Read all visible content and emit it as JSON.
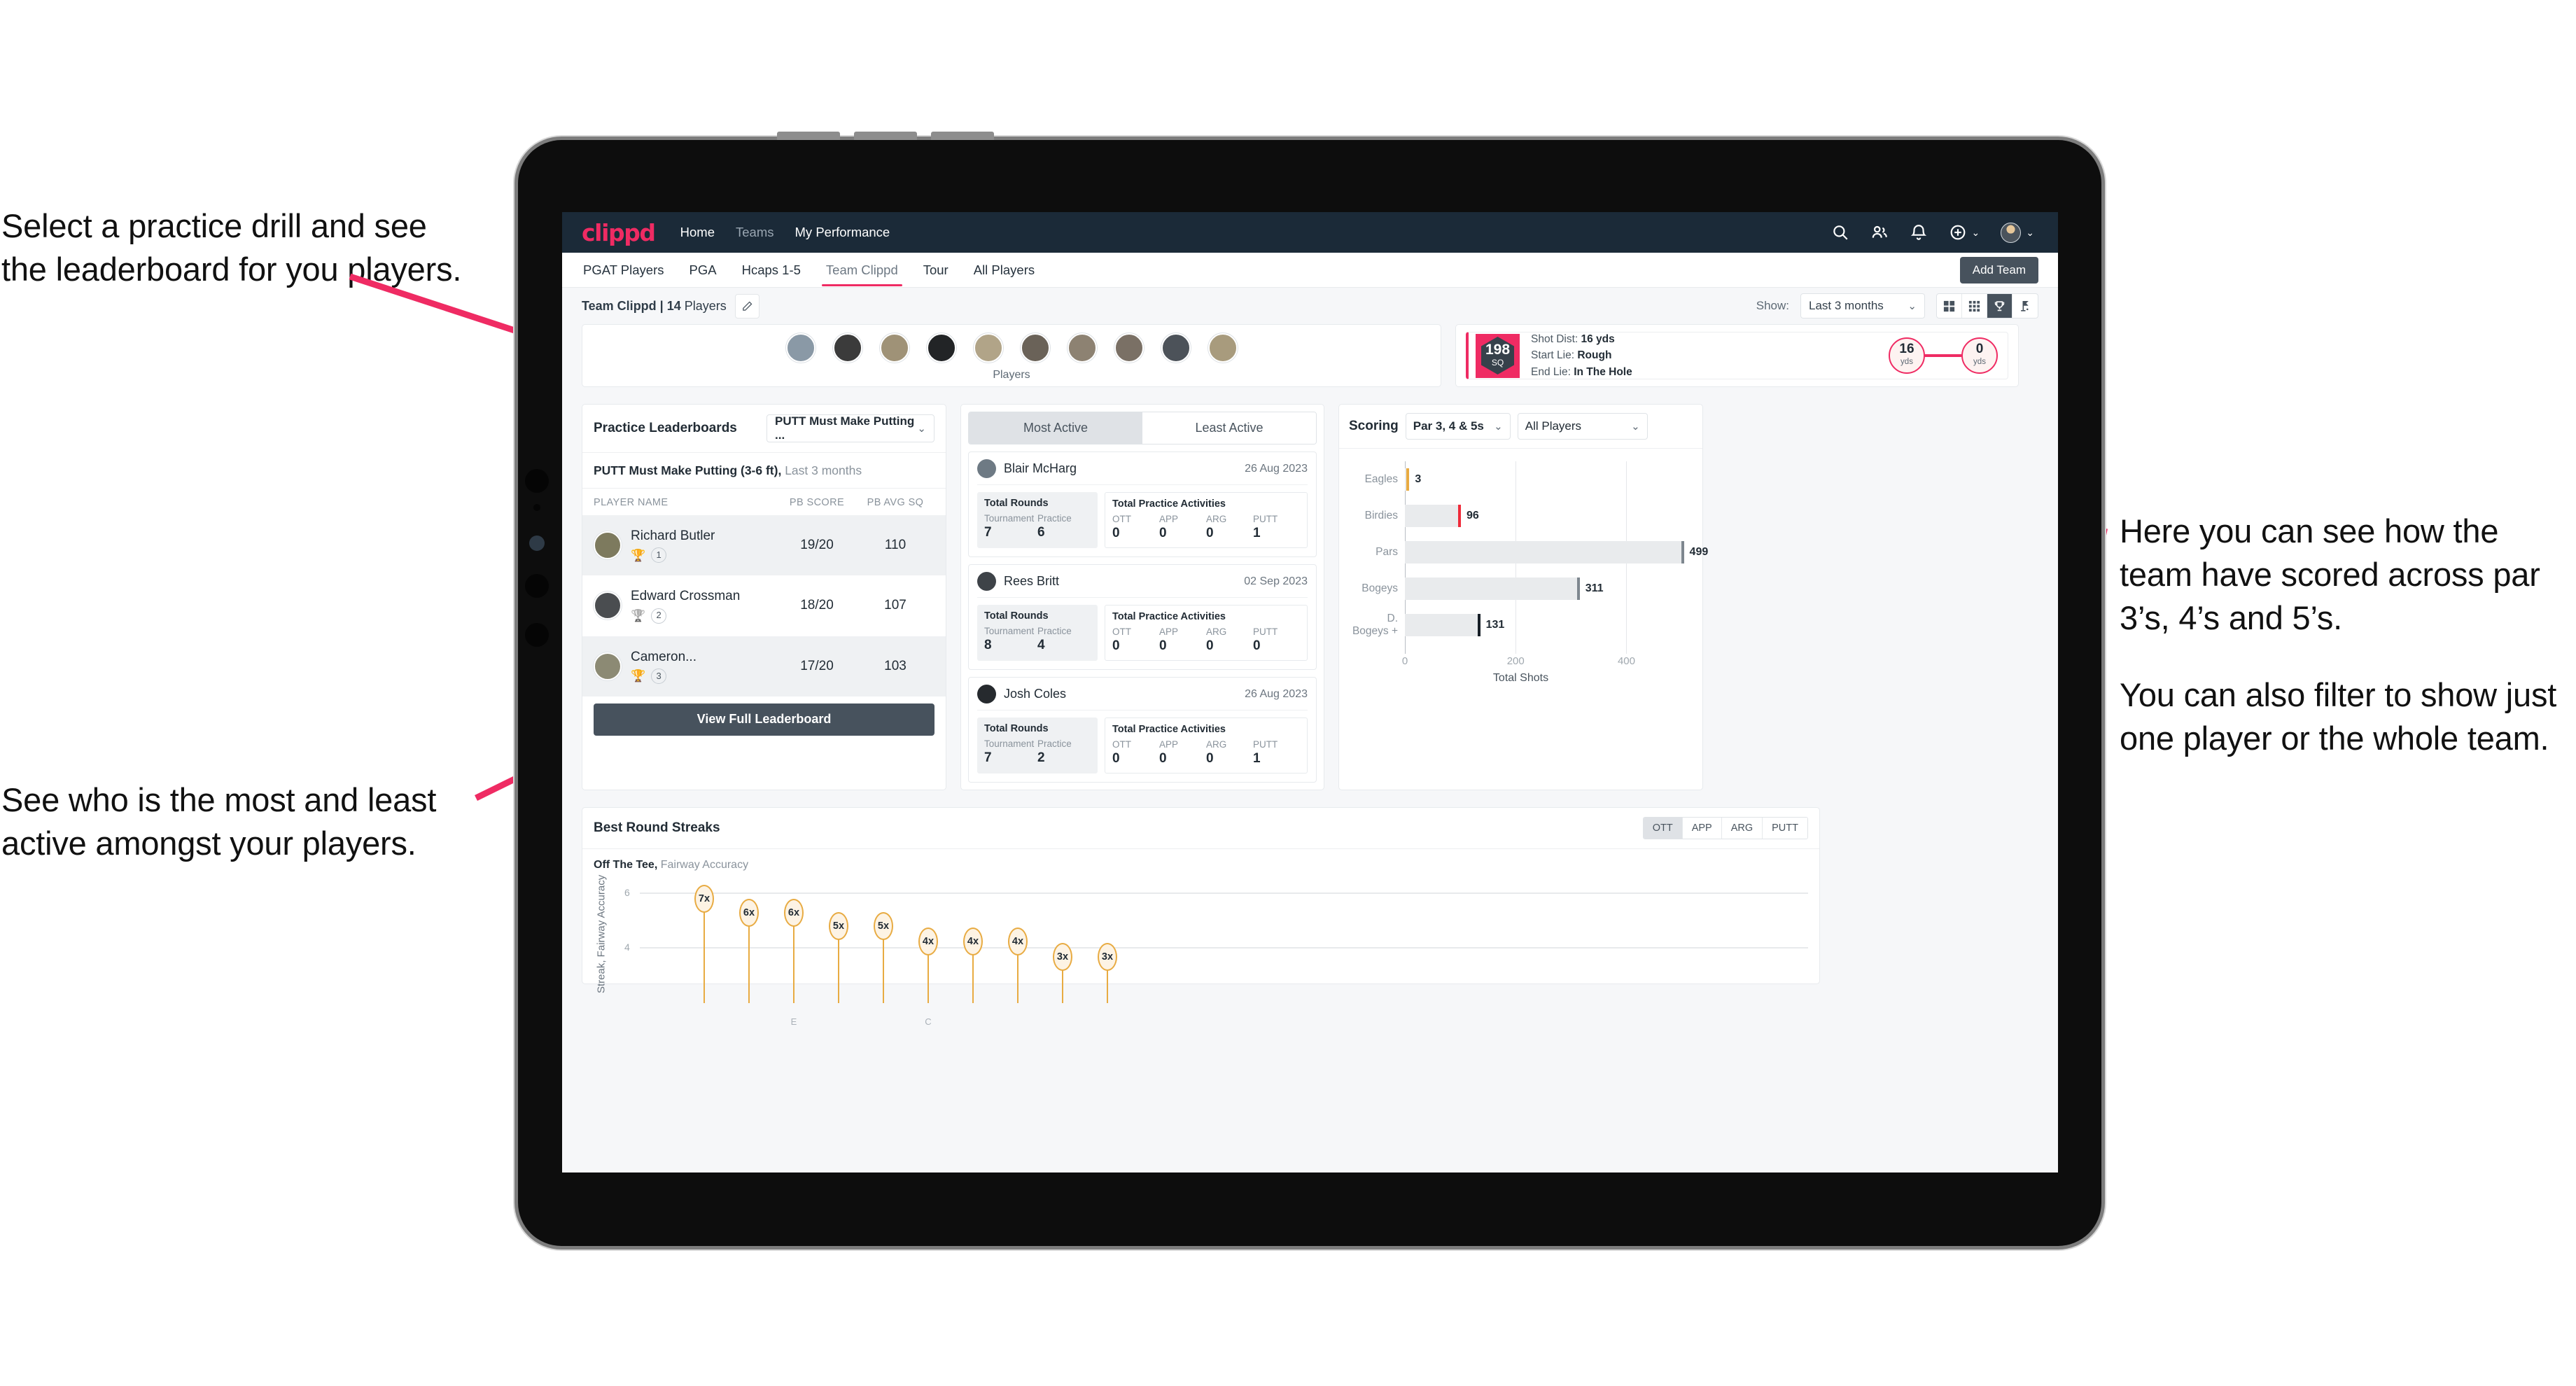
{
  "annotations": {
    "left_top_line1": "Select a practice drill and see",
    "left_top_line2": "the leaderboard for you players.",
    "left_bottom_line1": "See who is the most and least",
    "left_bottom_line2": "active amongst your players.",
    "right_p1": "Here you can see how the team have scored across par 3’s, 4’s and 5’s.",
    "right_p2": "You can also filter to show just one player or the whole team."
  },
  "colors": {
    "brand_pink": "#ef2b63",
    "navbar_bg": "#1b2a38",
    "dark_button": "#47525d",
    "gold": "#e8ab42",
    "page_bg": "#f6f7f9"
  },
  "navbar": {
    "logo": "clippd",
    "links": [
      {
        "label": "Home",
        "dim": false
      },
      {
        "label": "Teams",
        "dim": true
      },
      {
        "label": "My Performance",
        "dim": false
      }
    ],
    "icons": [
      {
        "name": "search-icon"
      },
      {
        "name": "people-icon"
      },
      {
        "name": "bell-icon"
      },
      {
        "name": "plus-circle-icon"
      }
    ],
    "caret": "⌄"
  },
  "tabs": {
    "items": [
      {
        "label": "PGAT Players",
        "active": false
      },
      {
        "label": "PGA",
        "active": false
      },
      {
        "label": "Hcaps 1-5",
        "active": false
      },
      {
        "label": "Team Clippd",
        "active": true
      },
      {
        "label": "Tour",
        "active": false
      },
      {
        "label": "All Players",
        "active": false
      }
    ],
    "add_team_label": "Add Team"
  },
  "subheader": {
    "team_name": "Team Clippd | 14",
    "team_suffix": " Players",
    "edit_icon": "pencil-icon",
    "show_label": "Show:",
    "period_value": "Last 3 months",
    "period_caret": "⌄",
    "view_buttons": [
      {
        "name": "grid-large-view",
        "active": false
      },
      {
        "name": "grid-small-view",
        "active": false
      },
      {
        "name": "trophy-view",
        "active": true
      },
      {
        "name": "golf-flag-view",
        "active": false
      }
    ]
  },
  "players_card": {
    "caption": "Players",
    "avatars": [
      "#8a99a6",
      "#3b3b3b",
      "#9f9277",
      "#222426",
      "#b1a488",
      "#6a6258",
      "#8d8272",
      "#7a7065",
      "#4c5259",
      "#a89b7d"
    ]
  },
  "shot_card": {
    "sq_value": "198",
    "sq_unit": "SQ",
    "lines": [
      {
        "label": "Shot Dist: ",
        "value": "16 yds"
      },
      {
        "label": "Start Lie: ",
        "value": "Rough"
      },
      {
        "label": "End Lie: ",
        "value": "In The Hole"
      }
    ],
    "start_dist": "16",
    "start_unit": "yds",
    "end_dist": "0",
    "end_unit": "yds"
  },
  "leaderboard": {
    "title": "Practice Leaderboards",
    "drill_select": "PUTT Must Make Putting ...",
    "drill_caret": "⌄",
    "subtitle_bold": "PUTT Must Make Putting (3-6 ft),",
    "subtitle_rest": " Last 3 months",
    "columns": [
      "PLAYER NAME",
      "PB SCORE",
      "PB AVG SQ"
    ],
    "rows": [
      {
        "name": "Richard Butler",
        "trophy": "🏆",
        "rank": "1",
        "pb_score": "19/20",
        "pb_avg_sq": "110",
        "alt": true,
        "av": "#7d7a5e"
      },
      {
        "name": "Edward Crossman",
        "trophy": "🏆",
        "rank": "2",
        "pb_score": "18/20",
        "pb_avg_sq": "107",
        "alt": false,
        "av": "#4a4d50"
      },
      {
        "name": "Cameron...",
        "trophy": "🏆",
        "rank": "3",
        "pb_score": "17/20",
        "pb_avg_sq": "103",
        "alt": true,
        "av": "#8c8a74"
      }
    ],
    "button_label": "View Full Leaderboard"
  },
  "activity": {
    "tabs": [
      {
        "label": "Most Active",
        "active": true
      },
      {
        "label": "Least Active",
        "active": false
      }
    ],
    "rounds_header": "Total Rounds",
    "rounds_keys": [
      "Tournament",
      "Practice"
    ],
    "acts_header": "Total Practice Activities",
    "acts_keys": [
      "OTT",
      "APP",
      "ARG",
      "PUTT"
    ],
    "items": [
      {
        "name": "Blair McHarg",
        "date": "26 Aug 2023",
        "rounds": [
          "7",
          "6"
        ],
        "acts": [
          "0",
          "0",
          "0",
          "1"
        ],
        "av": "#6e7a84"
      },
      {
        "name": "Rees Britt",
        "date": "02 Sep 2023",
        "rounds": [
          "8",
          "4"
        ],
        "acts": [
          "0",
          "0",
          "0",
          "0"
        ],
        "av": "#3e4348"
      },
      {
        "name": "Josh Coles",
        "date": "26 Aug 2023",
        "rounds": [
          "7",
          "2"
        ],
        "acts": [
          "0",
          "0",
          "0",
          "1"
        ],
        "av": "#262a2e"
      }
    ]
  },
  "scoring": {
    "title": "Scoring",
    "par_select": "Par 3, 4 & 5s",
    "player_select": "All Players",
    "caret": "⌄"
  },
  "streaks": {
    "title": "Best Round Streaks",
    "toggle": [
      {
        "label": "OTT",
        "active": true
      },
      {
        "label": "APP",
        "active": false
      },
      {
        "label": "ARG",
        "active": false
      },
      {
        "label": "PUTT",
        "active": false
      }
    ],
    "sub_bold": "Off The Tee,",
    "sub_rest": " Fairway Accuracy"
  },
  "chart_data": [
    {
      "type": "bar",
      "orientation": "horizontal",
      "title": "Scoring",
      "categories": [
        "Eagles",
        "Birdies",
        "Pars",
        "Bogeys",
        "D. Bogeys +"
      ],
      "values": [
        3,
        96,
        499,
        311,
        131
      ],
      "cap_colors": [
        "#e8ab42",
        "#ef2b3a",
        "#7e878f",
        "#7e878f",
        "#171f27"
      ],
      "bar_color": "#e9ebed",
      "xlabel": "Total Shots",
      "ylabel": "",
      "xlim": [
        0,
        520
      ],
      "xticks": [
        0,
        200,
        400
      ],
      "grid": true,
      "legend": false
    },
    {
      "type": "bar",
      "title": "Best Round Streaks",
      "subtitle": "Off The Tee, Fairway Accuracy",
      "ylabel": "Streak, Fairway Accuracy",
      "xlabel": "",
      "ylim": [
        0,
        7.6
      ],
      "yticks": [
        4,
        6
      ],
      "grid": true,
      "marker_style": "lollipop",
      "categories": [
        "",
        "",
        "E",
        "",
        "",
        "C",
        "",
        "",
        "",
        ""
      ],
      "labels": [
        "7x",
        "6x",
        "6x",
        "5x",
        "5x",
        "4x",
        "4x",
        "4x",
        "3x",
        "3x"
      ],
      "values": [
        7,
        6,
        6,
        5,
        5,
        4,
        4,
        4,
        3,
        3
      ]
    }
  ]
}
